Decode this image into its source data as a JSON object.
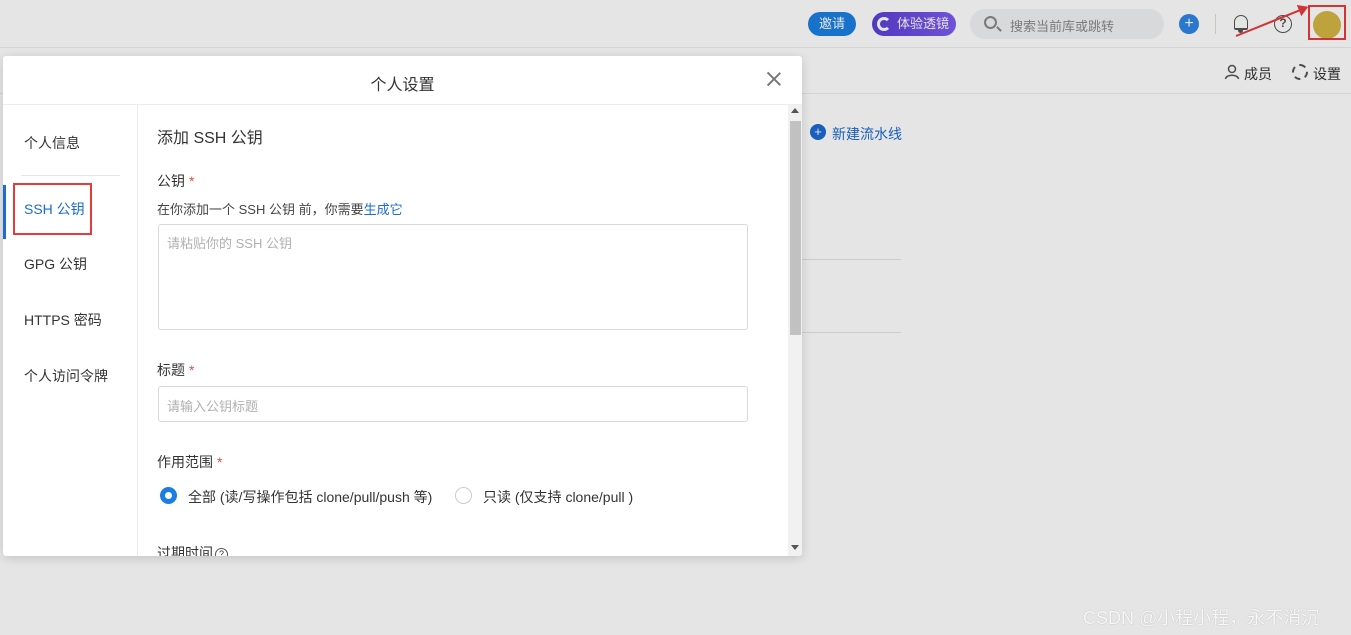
{
  "topbar": {
    "invite_label": "邀请",
    "lens_label": "体验透镜",
    "search_placeholder": "搜索当前库或跳转",
    "plus_label": "+",
    "help_label": "?"
  },
  "subbar": {
    "member_label": "成员",
    "settings_label": "设置"
  },
  "background": {
    "new_pipeline_label": "新建流水线"
  },
  "modal": {
    "title": "个人设置",
    "nav": [
      {
        "label": "个人信息"
      },
      {
        "label": "SSH 公钥",
        "active": true
      },
      {
        "label": "GPG 公钥"
      },
      {
        "label": "HTTPS 密码"
      },
      {
        "label": "个人访问令牌"
      }
    ],
    "section_title": "添加 SSH 公钥",
    "key_label": "公钥",
    "hint_text": "在你添加一个 SSH 公钥 前，你需要",
    "hint_link": "生成它",
    "key_placeholder": "请粘贴你的 SSH 公钥",
    "title_label": "标题",
    "title_placeholder": "请输入公钥标题",
    "scope_label": "作用范围",
    "scope_options": [
      {
        "label": "全部 (读/写操作包括 clone/pull/push 等)",
        "checked": true
      },
      {
        "label": "只读 (仅支持 clone/pull )",
        "checked": false
      }
    ],
    "expire_label": "过期时间",
    "required_mark": "*"
  },
  "watermark": "CSDN @小程小程，永不消沉",
  "colors": {
    "accent": "#1b6bd1",
    "highlight": "#e83a3a",
    "required": "#e84a4a"
  }
}
